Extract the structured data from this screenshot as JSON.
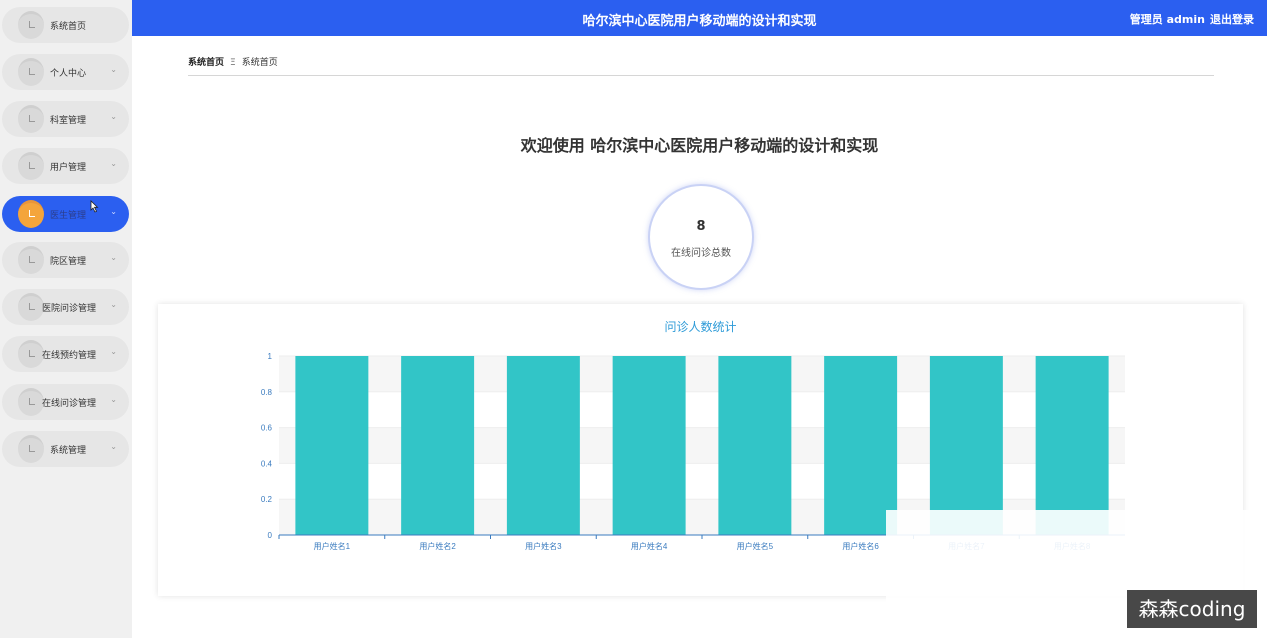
{
  "sidebar": {
    "items": [
      {
        "label": "系统首页",
        "chevron": ""
      },
      {
        "label": "个人中心",
        "chevron": "⌄"
      },
      {
        "label": "科室管理",
        "chevron": "⌄"
      },
      {
        "label": "用户管理",
        "chevron": "⌄"
      },
      {
        "label": "医生管理",
        "chevron": "⌄"
      },
      {
        "label": "院区管理",
        "chevron": "⌄"
      },
      {
        "label": "医院问诊管理",
        "chevron": "⌄"
      },
      {
        "label": "在线预约管理",
        "chevron": "⌄"
      },
      {
        "label": "在线问诊管理",
        "chevron": "⌄"
      },
      {
        "label": "系统管理",
        "chevron": "⌄"
      }
    ],
    "active_index": 4
  },
  "header": {
    "title": "哈尔滨中心医院用户移动端的设计和实现",
    "user": "管理员 admin",
    "logout": "退出登录"
  },
  "breadcrumb": {
    "root": "系统首页",
    "separator": "Ξ",
    "current": "系统首页"
  },
  "welcome": "欢迎使用 哈尔滨中心医院用户移动端的设计和实现",
  "stat": {
    "value": "8",
    "label": "在线问诊总数"
  },
  "chart": {
    "title": "问诊人数统计"
  },
  "chart_data": {
    "type": "bar",
    "title": "问诊人数统计",
    "categories": [
      "用户姓名1",
      "用户姓名2",
      "用户姓名3",
      "用户姓名4",
      "用户姓名5",
      "用户姓名6",
      "用户姓名7",
      "用户姓名8"
    ],
    "values": [
      1,
      1,
      1,
      1,
      1,
      1,
      1,
      1
    ],
    "yticks": [
      "0",
      "0.2",
      "0.4",
      "0.6",
      "0.8",
      "1"
    ],
    "ylim": [
      0,
      1
    ],
    "bar_color": "#32c5c7",
    "grid": true
  },
  "watermark": "森森coding",
  "colors": {
    "accent": "#2b5ff0",
    "active_icon": "#f4a53c"
  }
}
